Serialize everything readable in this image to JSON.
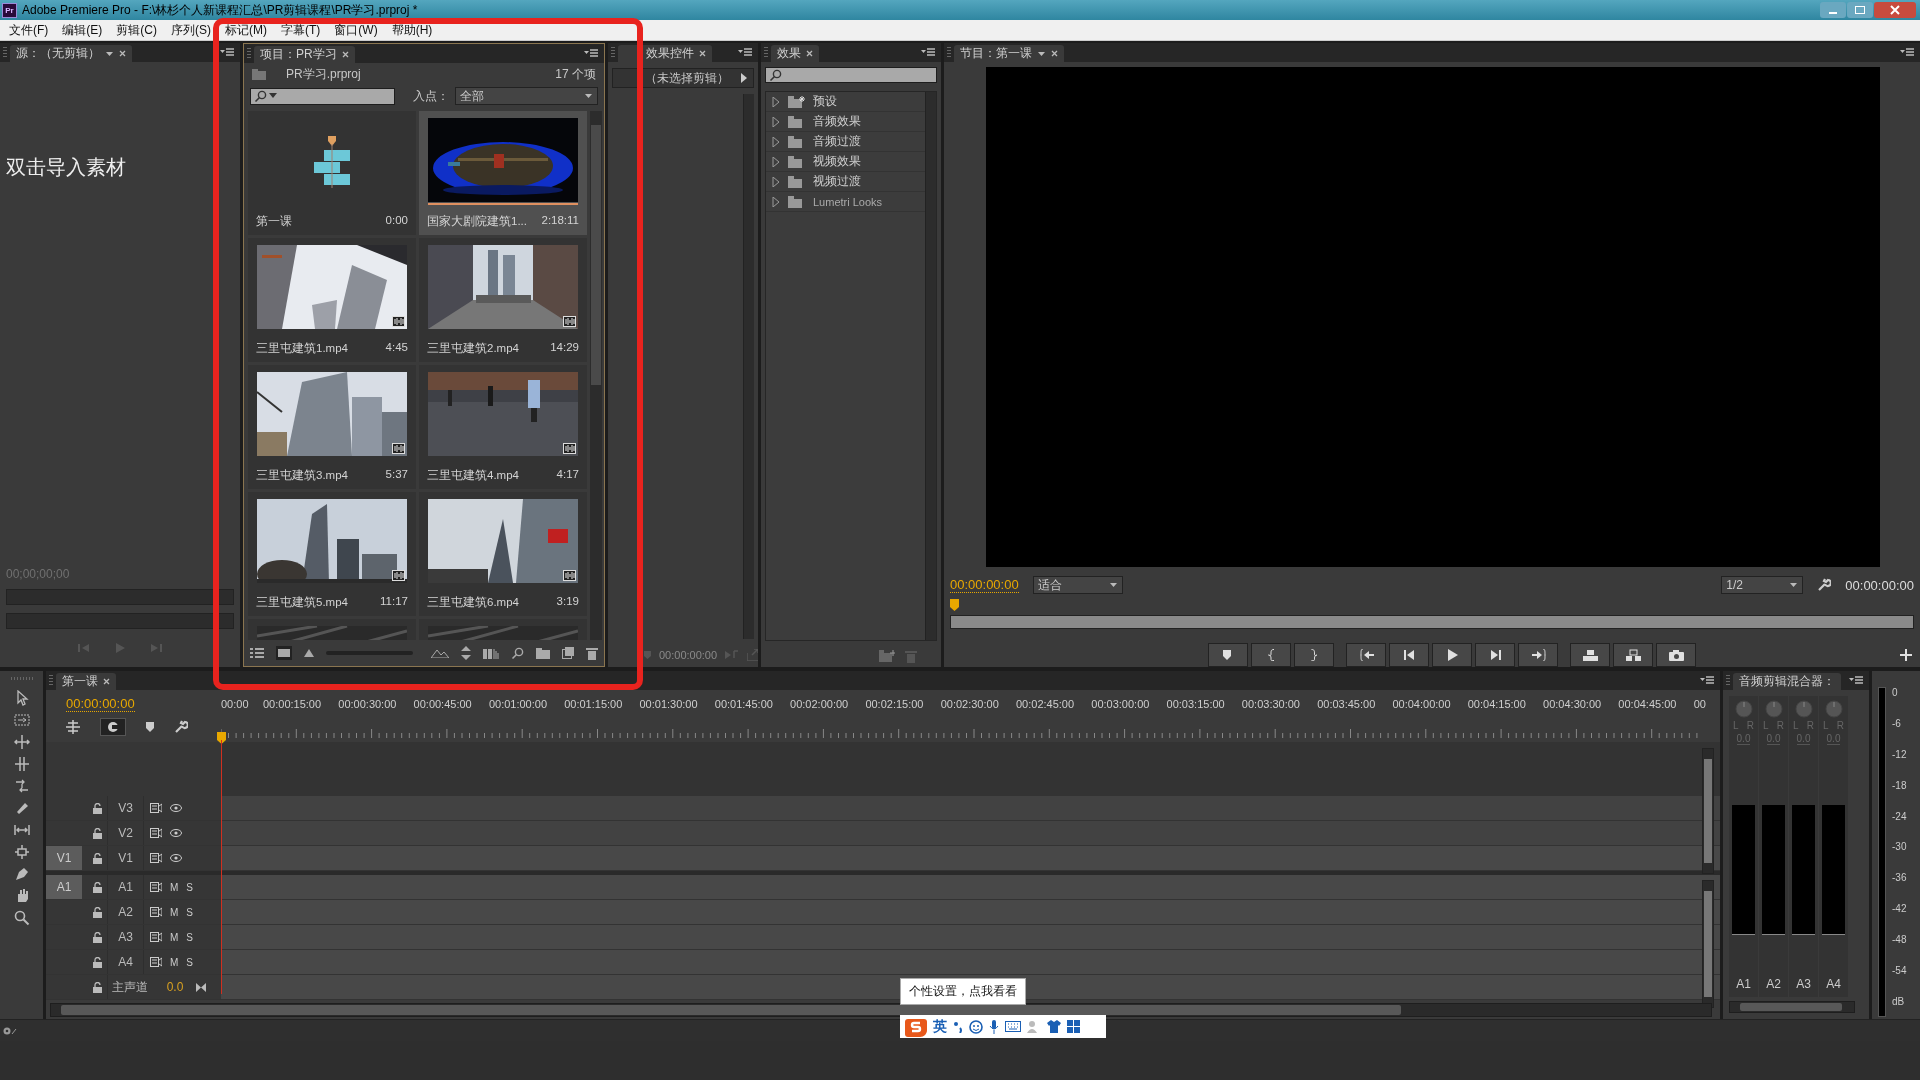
{
  "window": {
    "logo": "Pr",
    "title": "Adobe Premiere Pro - F:\\林杉个人新课程汇总\\PR剪辑课程\\PR学习.prproj *"
  },
  "menu": [
    "文件(F)",
    "编辑(E)",
    "剪辑(C)",
    "序列(S)",
    "标记(M)",
    "字幕(T)",
    "窗口(W)",
    "帮助(H)"
  ],
  "source_panel": {
    "tab": "源：（无剪辑）",
    "hint": "双击导入素材",
    "timecode": "00;00;00;00"
  },
  "project_panel": {
    "tab": "项目：PR学习",
    "file": "PR学习.prproj",
    "count": "17 个项",
    "inpoint_label": "入点：",
    "inpoint_value": "全部",
    "items": [
      {
        "kind": "sequence",
        "name": "第一课",
        "duration": "0:00",
        "selected": false
      },
      {
        "kind": "video",
        "name": "国家大剧院建筑1...",
        "duration": "2:18:11",
        "selected": true
      },
      {
        "kind": "video",
        "name": "三里屯建筑1.mp4",
        "duration": "4:45",
        "selected": false
      },
      {
        "kind": "video",
        "name": "三里屯建筑2.mp4",
        "duration": "14:29",
        "selected": false
      },
      {
        "kind": "video",
        "name": "三里屯建筑3.mp4",
        "duration": "5:37",
        "selected": false
      },
      {
        "kind": "video",
        "name": "三里屯建筑4.mp4",
        "duration": "4:17",
        "selected": false
      },
      {
        "kind": "video",
        "name": "三里屯建筑5.mp4",
        "duration": "11:17",
        "selected": false
      },
      {
        "kind": "video",
        "name": "三里屯建筑6.mp4",
        "duration": "3:19",
        "selected": false
      },
      {
        "kind": "clipped",
        "selected": false
      },
      {
        "kind": "clipped",
        "selected": false
      }
    ]
  },
  "effect_controls_panel": {
    "tab": "效果控件",
    "hint": "（未选择剪辑）",
    "timecode": "00:00:00:00"
  },
  "effects_panel": {
    "tab": "效果",
    "tree": [
      {
        "kind": "preset",
        "label": "预设",
        "expanded": false
      },
      {
        "kind": "folder",
        "label": "音频效果",
        "expanded": false
      },
      {
        "kind": "folder",
        "label": "音频过渡",
        "expanded": false
      },
      {
        "kind": "folder",
        "label": "视频效果",
        "expanded": false
      },
      {
        "kind": "folder",
        "label": "视频过渡",
        "expanded": false
      },
      {
        "kind": "folder",
        "label": "Lumetri Looks",
        "expanded": false
      }
    ]
  },
  "program_panel": {
    "tab": "节目：第一课",
    "timecode": "00:00:00:00",
    "zoom": "适合",
    "resolution": "1/2",
    "duration": "00:00:00:00"
  },
  "timeline": {
    "tab": "第一课",
    "timecode": "00:00:00:00",
    "ruler": [
      "00:00",
      "00:00:15:00",
      "00:00:30:00",
      "00:00:45:00",
      "00:01:00:00",
      "00:01:15:00",
      "00:01:30:00",
      "00:01:45:00",
      "00:02:00:00",
      "00:02:15:00",
      "00:02:30:00",
      "00:02:45:00",
      "00:03:00:00",
      "00:03:15:00",
      "00:03:30:00",
      "00:03:45:00",
      "00:04:00:00",
      "00:04:15:00",
      "00:04:30:00",
      "00:04:45:00",
      "00"
    ],
    "tracks": [
      {
        "kind": "video",
        "name": "V3"
      },
      {
        "kind": "video",
        "name": "V2"
      },
      {
        "kind": "video",
        "name": "V1",
        "patch": "V1"
      },
      {
        "kind": "audio",
        "name": "A1",
        "patch": "A1",
        "mute": "M",
        "solo": "S"
      },
      {
        "kind": "audio",
        "name": "A2",
        "mute": "M",
        "solo": "S"
      },
      {
        "kind": "audio",
        "name": "A3",
        "mute": "M",
        "solo": "S"
      },
      {
        "kind": "audio",
        "name": "A4",
        "mute": "M",
        "solo": "S"
      },
      {
        "kind": "master",
        "name": "主声道",
        "value": "0.0"
      }
    ]
  },
  "audio_mixer": {
    "tab": "音频剪辑混合器：",
    "channels": [
      {
        "name": "A1",
        "left": "L",
        "right": "R",
        "gain": "0.0"
      },
      {
        "name": "A2",
        "left": "L",
        "right": "R",
        "gain": "0.0"
      },
      {
        "name": "A3",
        "left": "L",
        "right": "R",
        "gain": "0.0"
      },
      {
        "name": "A4",
        "left": "L",
        "right": "R",
        "gain": "0.0"
      }
    ]
  },
  "meter": {
    "scale": [
      "0",
      "-6",
      "-12",
      "-18",
      "-24",
      "-30",
      "-36",
      "-42",
      "-48",
      "-54",
      "dB"
    ]
  },
  "ime": {
    "tooltip": "个性设置，点我看看",
    "mode": "英"
  }
}
